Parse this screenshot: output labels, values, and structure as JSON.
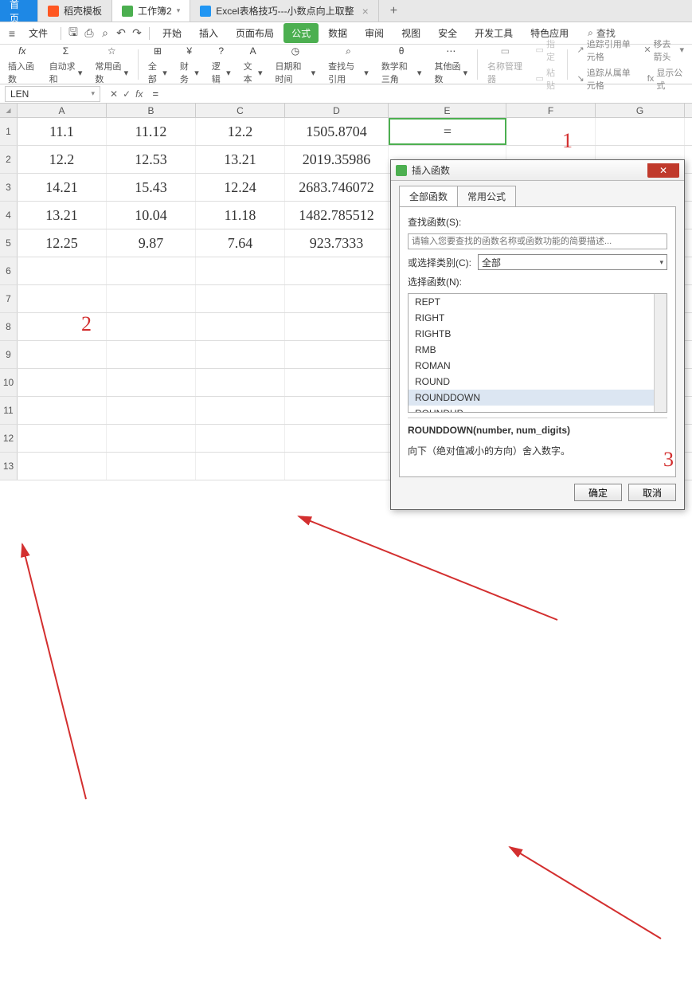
{
  "tabs": {
    "home": "首页",
    "t1": "稻壳模板",
    "t2": "工作簿2",
    "t3": "Excel表格技巧---小数点向上取整",
    "add": "+"
  },
  "file_menu": "文件",
  "menus": [
    "开始",
    "插入",
    "页面布局",
    "公式",
    "数据",
    "审阅",
    "视图",
    "安全",
    "开发工具",
    "特色应用"
  ],
  "search": "查找",
  "ribbon": {
    "insert_fn": "插入函数",
    "autosum": "自动求和",
    "common": "常用函数",
    "all": "全部",
    "financial": "财务",
    "logical": "逻辑",
    "text": "文本",
    "datetime": "日期和时间",
    "lookup": "查找与引用",
    "math": "数学和三角",
    "other": "其他函数",
    "name_mgr": "名称管理器",
    "paste": "粘贴",
    "specify": "指定",
    "trace_prec": "追踪引用单元格",
    "trace_dep": "追踪从属单元格",
    "remove_arrow": "移去箭头",
    "show_formula": "显示公式"
  },
  "name_box": "LEN",
  "formula": "=",
  "columns": [
    "A",
    "B",
    "C",
    "D",
    "E",
    "F",
    "G"
  ],
  "rows": [
    {
      "n": "1",
      "A": "11.1",
      "B": "11.12",
      "C": "12.2",
      "D": "1505.8704",
      "E": "="
    },
    {
      "n": "2",
      "A": "12.2",
      "B": "12.53",
      "C": "13.21",
      "D": "2019.35986",
      "E": ""
    },
    {
      "n": "3",
      "A": "14.21",
      "B": "15.43",
      "C": "12.24",
      "D": "2683.746072",
      "E": ""
    },
    {
      "n": "4",
      "A": "13.21",
      "B": "10.04",
      "C": "11.18",
      "D": "1482.785512",
      "E": ""
    },
    {
      "n": "5",
      "A": "12.25",
      "B": "9.87",
      "C": "7.64",
      "D": "923.7333",
      "E": ""
    },
    {
      "n": "6"
    },
    {
      "n": "7"
    },
    {
      "n": "8"
    },
    {
      "n": "9"
    },
    {
      "n": "10"
    },
    {
      "n": "11"
    },
    {
      "n": "12"
    },
    {
      "n": "13"
    }
  ],
  "dialog": {
    "title": "插入函数",
    "tab_all": "全部函数",
    "tab_common": "常用公式",
    "search_label": "查找函数(S):",
    "search_placeholder": "请输入您要查找的函数名称或函数功能的简要描述...",
    "category_label": "或选择类别(C):",
    "category_value": "全部",
    "select_label": "选择函数(N):",
    "functions": [
      "REPT",
      "RIGHT",
      "RIGHTB",
      "RMB",
      "ROMAN",
      "ROUND",
      "ROUNDDOWN",
      "ROUNDUP"
    ],
    "selected_fn": "ROUNDDOWN",
    "signature": "ROUNDDOWN(number, num_digits)",
    "description": "向下（绝对值减小的方向）舍入数字。",
    "ok": "确定",
    "cancel": "取消"
  },
  "annotations": {
    "a1": "1",
    "a2": "2",
    "a3": "3"
  }
}
